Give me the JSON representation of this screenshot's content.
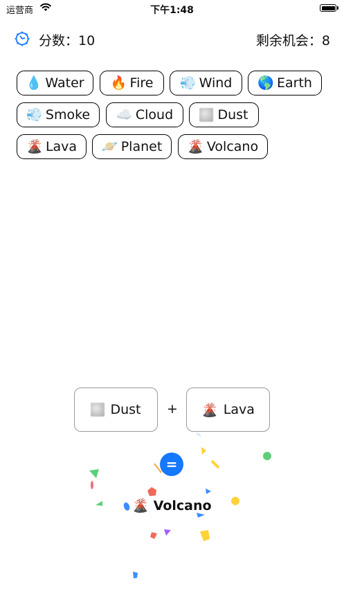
{
  "status_bar": {
    "carrier": "运营商",
    "time": "下午1:48"
  },
  "header": {
    "score_label": "分数：10",
    "remaining_label": "剩余机会：8"
  },
  "elements": [
    {
      "emoji": "💧",
      "label": "Water"
    },
    {
      "emoji": "🔥",
      "label": "Fire"
    },
    {
      "emoji": "💨",
      "label": "Wind"
    },
    {
      "emoji": "🌎",
      "label": "Earth"
    },
    {
      "emoji": "💨",
      "label": "Smoke"
    },
    {
      "emoji": "☁️",
      "label": "Cloud"
    },
    {
      "emoji": "",
      "label": "Dust"
    },
    {
      "emoji": "🌋",
      "label": "Lava"
    },
    {
      "emoji": "🪐",
      "label": "Planet"
    },
    {
      "emoji": "🌋",
      "label": "Volcano"
    }
  ],
  "combine": {
    "left": {
      "emoji": "",
      "label": "Dust"
    },
    "operator": "+",
    "right": {
      "emoji": "🌋",
      "label": "Lava"
    },
    "equals_label": "=",
    "result": "🌋 Volcano"
  }
}
